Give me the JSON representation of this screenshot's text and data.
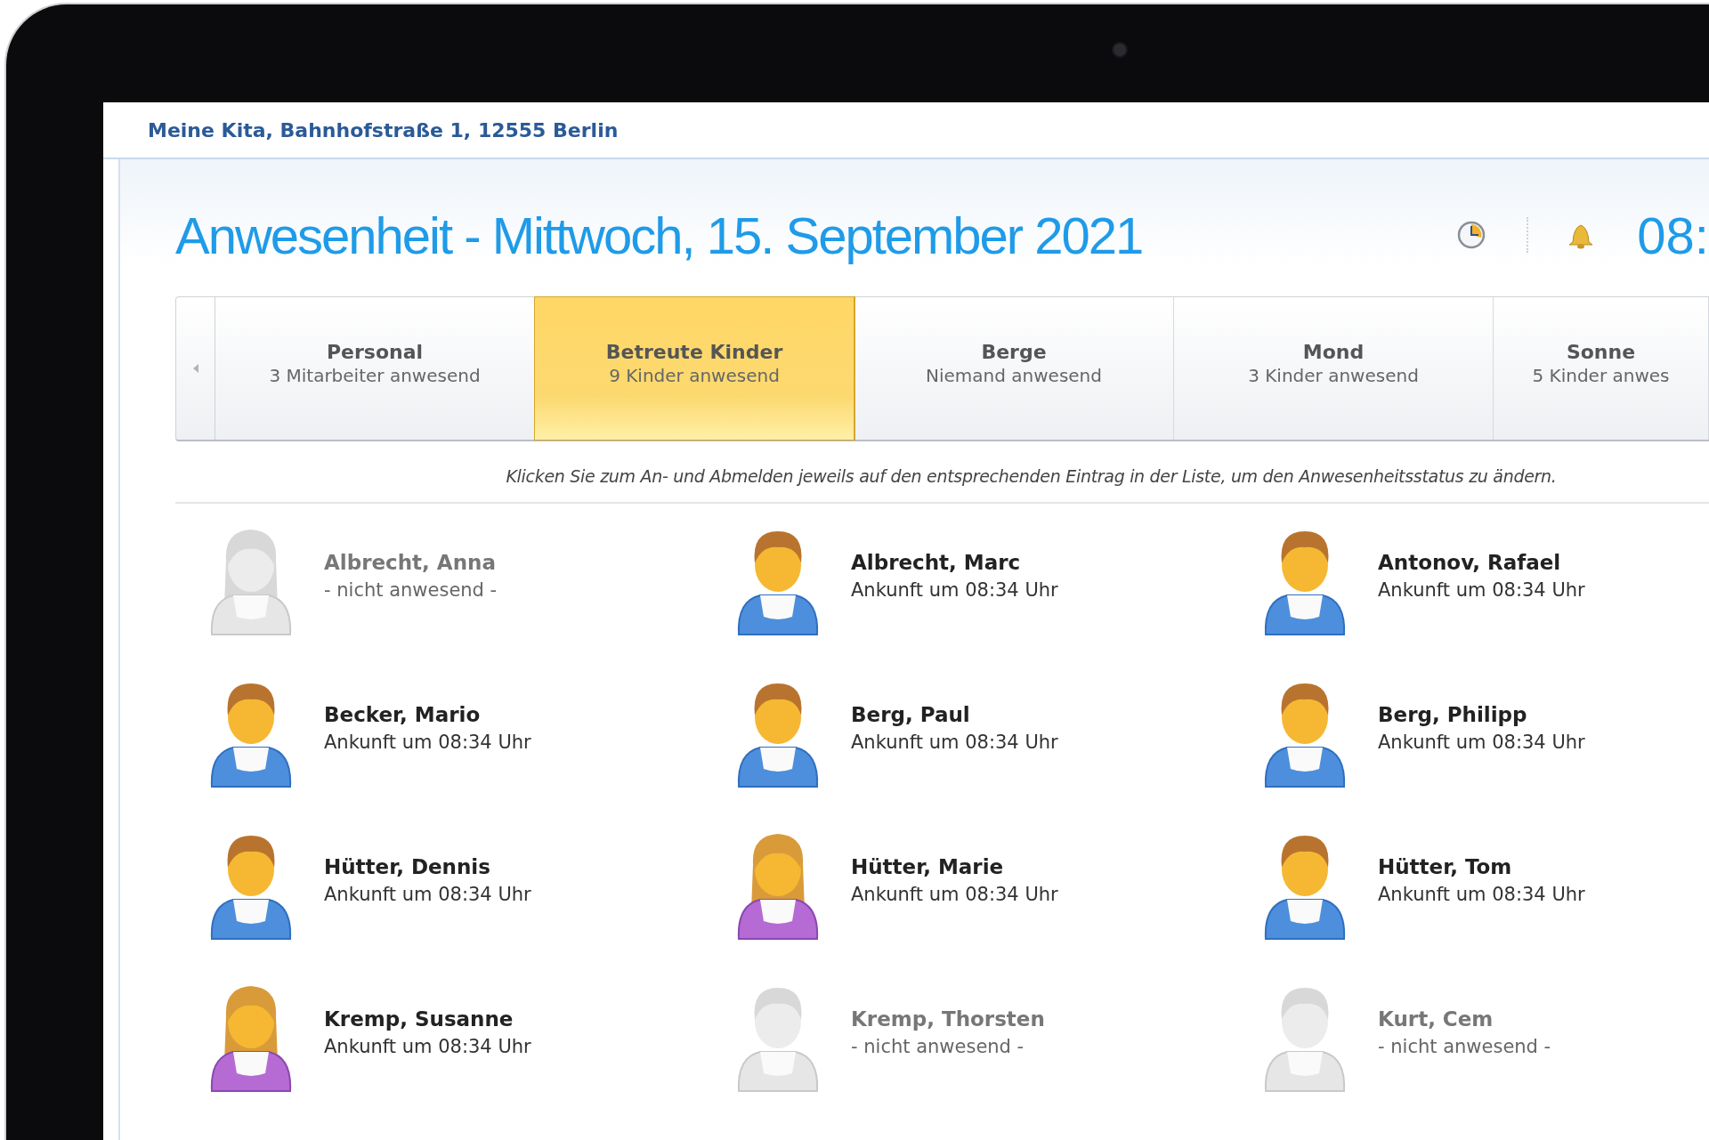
{
  "header": {
    "title": "Meine Kita, Bahnhofstraße 1, 12555 Berlin"
  },
  "page_title": "Anwesenheit - Mittwoch, 15. September 2021",
  "clock": "08:",
  "tabs": [
    {
      "label": "Personal",
      "sub": "3 Mitarbeiter anwesend",
      "selected": false
    },
    {
      "label": "Betreute Kinder",
      "sub": "9 Kinder anwesend",
      "selected": true
    },
    {
      "label": "Berge",
      "sub": "Niemand anwesend",
      "selected": false
    },
    {
      "label": "Mond",
      "sub": "3 Kinder anwesend",
      "selected": false
    },
    {
      "label": "Sonne",
      "sub": "5 Kinder anwes",
      "selected": false
    }
  ],
  "hint": "Klicken Sie zum An- und Abmelden jeweils auf den entsprechenden Eintrag in der Liste, um den Anwesenheitsstatus zu ändern.",
  "children": [
    {
      "name": "Albrecht, Anna",
      "status": "- nicht anwesend -",
      "kind": "girl",
      "present": false
    },
    {
      "name": "Albrecht, Marc",
      "status": "Ankunft um 08:34 Uhr",
      "kind": "boy",
      "present": true
    },
    {
      "name": "Antonov, Rafael",
      "status": "Ankunft um 08:34 Uhr",
      "kind": "boy",
      "present": true
    },
    {
      "name": "Becker, Mario",
      "status": "Ankunft um 08:34 Uhr",
      "kind": "boy",
      "present": true
    },
    {
      "name": "Berg, Paul",
      "status": "Ankunft um 08:34 Uhr",
      "kind": "boy",
      "present": true
    },
    {
      "name": "Berg, Philipp",
      "status": "Ankunft um 08:34 Uhr",
      "kind": "boy",
      "present": true
    },
    {
      "name": "Hütter, Dennis",
      "status": "Ankunft um 08:34 Uhr",
      "kind": "boy",
      "present": true
    },
    {
      "name": "Hütter, Marie",
      "status": "Ankunft um 08:34 Uhr",
      "kind": "girl",
      "present": true
    },
    {
      "name": "Hütter, Tom",
      "status": "Ankunft um 08:34 Uhr",
      "kind": "boy",
      "present": true
    },
    {
      "name": "Kremp, Susanne",
      "status": "Ankunft um 08:34 Uhr",
      "kind": "girl",
      "present": true
    },
    {
      "name": "Kremp, Thorsten",
      "status": "- nicht anwesend -",
      "kind": "boy",
      "present": false
    },
    {
      "name": "Kurt, Cem",
      "status": "- nicht anwesend -",
      "kind": "boy",
      "present": false
    }
  ]
}
